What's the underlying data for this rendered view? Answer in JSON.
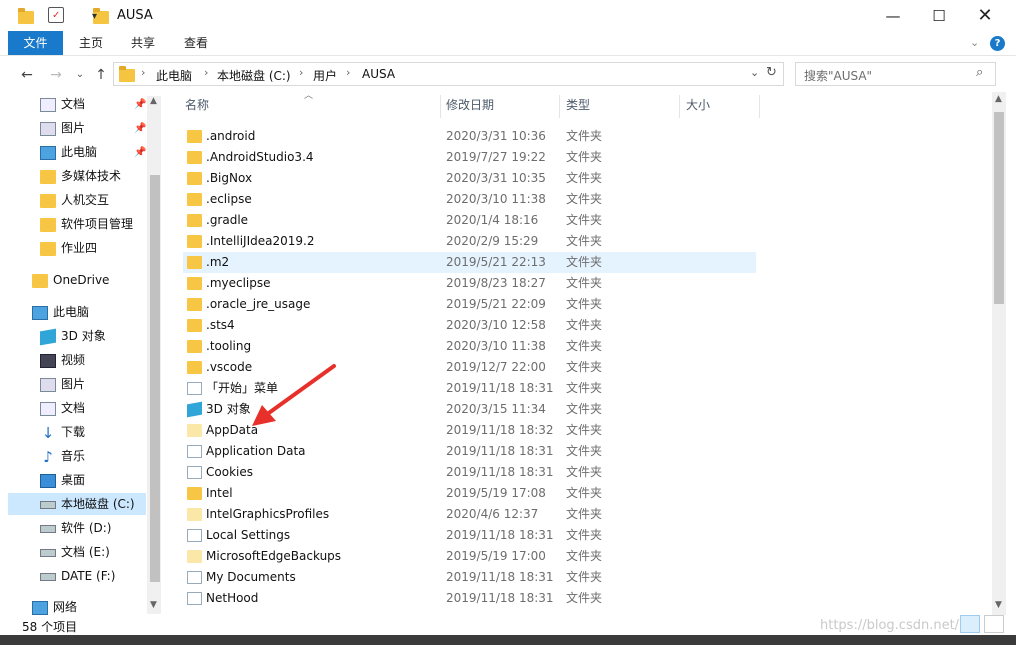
{
  "window": {
    "title": "AUSA"
  },
  "ribbon": {
    "tabs": [
      "文件",
      "主页",
      "共享",
      "查看"
    ]
  },
  "address": {
    "crumbs": [
      "此电脑",
      "本地磁盘 (C:)",
      "用户",
      "AUSA"
    ]
  },
  "search": {
    "placeholder": "搜索\"AUSA\""
  },
  "columns": {
    "name": "名称",
    "date": "修改日期",
    "type": "类型",
    "size": "大小"
  },
  "nav": {
    "quick": [
      "文档",
      "图片",
      "此电脑",
      "多媒体技术",
      "人机交互",
      "软件项目管理",
      "作业四"
    ],
    "onedrive": "OneDrive",
    "thispc": "此电脑",
    "pc_items": [
      "3D 对象",
      "视频",
      "图片",
      "文档",
      "下载",
      "音乐",
      "桌面",
      "本地磁盘 (C:)",
      "软件 (D:)",
      "文档 (E:)",
      "DATE (F:)"
    ],
    "network": "网络"
  },
  "files": [
    {
      "name": ".android",
      "date": "2020/3/31 10:36",
      "type": "文件夹",
      "icon": "folder"
    },
    {
      "name": ".AndroidStudio3.4",
      "date": "2019/7/27 19:22",
      "type": "文件夹",
      "icon": "folder"
    },
    {
      "name": ".BigNox",
      "date": "2020/3/31 10:35",
      "type": "文件夹",
      "icon": "folder"
    },
    {
      "name": ".eclipse",
      "date": "2020/3/10 11:38",
      "type": "文件夹",
      "icon": "folder"
    },
    {
      "name": ".gradle",
      "date": "2020/1/4 18:16",
      "type": "文件夹",
      "icon": "folder"
    },
    {
      "name": ".IntelliJIdea2019.2",
      "date": "2020/2/9 15:29",
      "type": "文件夹",
      "icon": "folder"
    },
    {
      "name": ".m2",
      "date": "2019/5/21 22:13",
      "type": "文件夹",
      "icon": "folder"
    },
    {
      "name": ".myeclipse",
      "date": "2019/8/23 18:27",
      "type": "文件夹",
      "icon": "folder"
    },
    {
      "name": ".oracle_jre_usage",
      "date": "2019/5/21 22:09",
      "type": "文件夹",
      "icon": "folder"
    },
    {
      "name": ".sts4",
      "date": "2020/3/10 12:58",
      "type": "文件夹",
      "icon": "folder"
    },
    {
      "name": ".tooling",
      "date": "2020/3/10 11:38",
      "type": "文件夹",
      "icon": "folder"
    },
    {
      "name": ".vscode",
      "date": "2019/12/7 22:00",
      "type": "文件夹",
      "icon": "folder"
    },
    {
      "name": "「开始」菜单",
      "date": "2019/11/18 18:31",
      "type": "文件夹",
      "icon": "link"
    },
    {
      "name": "3D 对象",
      "date": "2020/3/15 11:34",
      "type": "文件夹",
      "icon": "cube"
    },
    {
      "name": "AppData",
      "date": "2019/11/18 18:32",
      "type": "文件夹",
      "icon": "pale"
    },
    {
      "name": "Application Data",
      "date": "2019/11/18 18:31",
      "type": "文件夹",
      "icon": "link"
    },
    {
      "name": "Cookies",
      "date": "2019/11/18 18:31",
      "type": "文件夹",
      "icon": "link"
    },
    {
      "name": "Intel",
      "date": "2019/5/19 17:08",
      "type": "文件夹",
      "icon": "folder"
    },
    {
      "name": "IntelGraphicsProfiles",
      "date": "2020/4/6 12:37",
      "type": "文件夹",
      "icon": "pale"
    },
    {
      "name": "Local Settings",
      "date": "2019/11/18 18:31",
      "type": "文件夹",
      "icon": "link"
    },
    {
      "name": "MicrosoftEdgeBackups",
      "date": "2019/5/19 17:00",
      "type": "文件夹",
      "icon": "pale"
    },
    {
      "name": "My Documents",
      "date": "2019/11/18 18:31",
      "type": "文件夹",
      "icon": "link"
    },
    {
      "name": "NetHood",
      "date": "2019/11/18 18:31",
      "type": "文件夹",
      "icon": "link"
    }
  ],
  "selected_index": 6,
  "status": {
    "count": "58 个项目"
  },
  "watermark": "https://blog.csdn.net/..."
}
